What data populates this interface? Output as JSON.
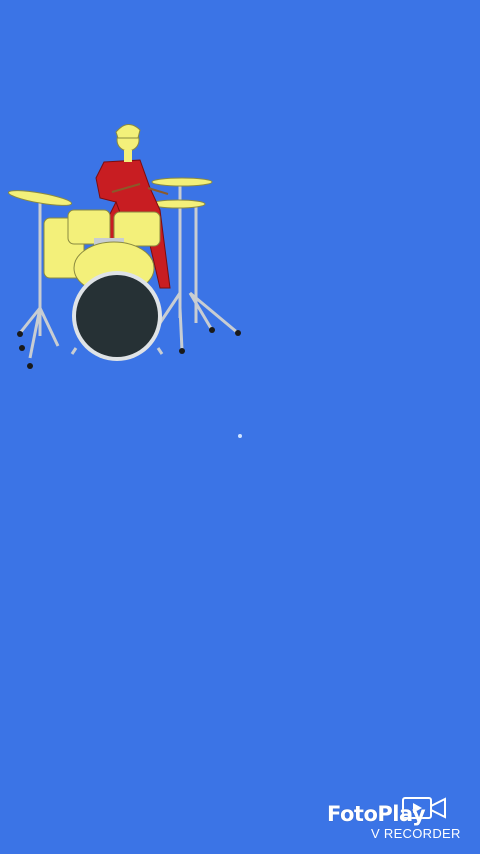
{
  "screen": {
    "background_color": "#3b74e6"
  },
  "drummer_illustration": {
    "shirt_color": "#c81d22",
    "drum_color": "#f3f07a",
    "bass_head_color": "#263135",
    "hardware_color": "#c8cdd2"
  },
  "watermark": {
    "brand": "FotoPlay",
    "subtitle": "V RECORDER",
    "icon": "video-camera-icon"
  }
}
